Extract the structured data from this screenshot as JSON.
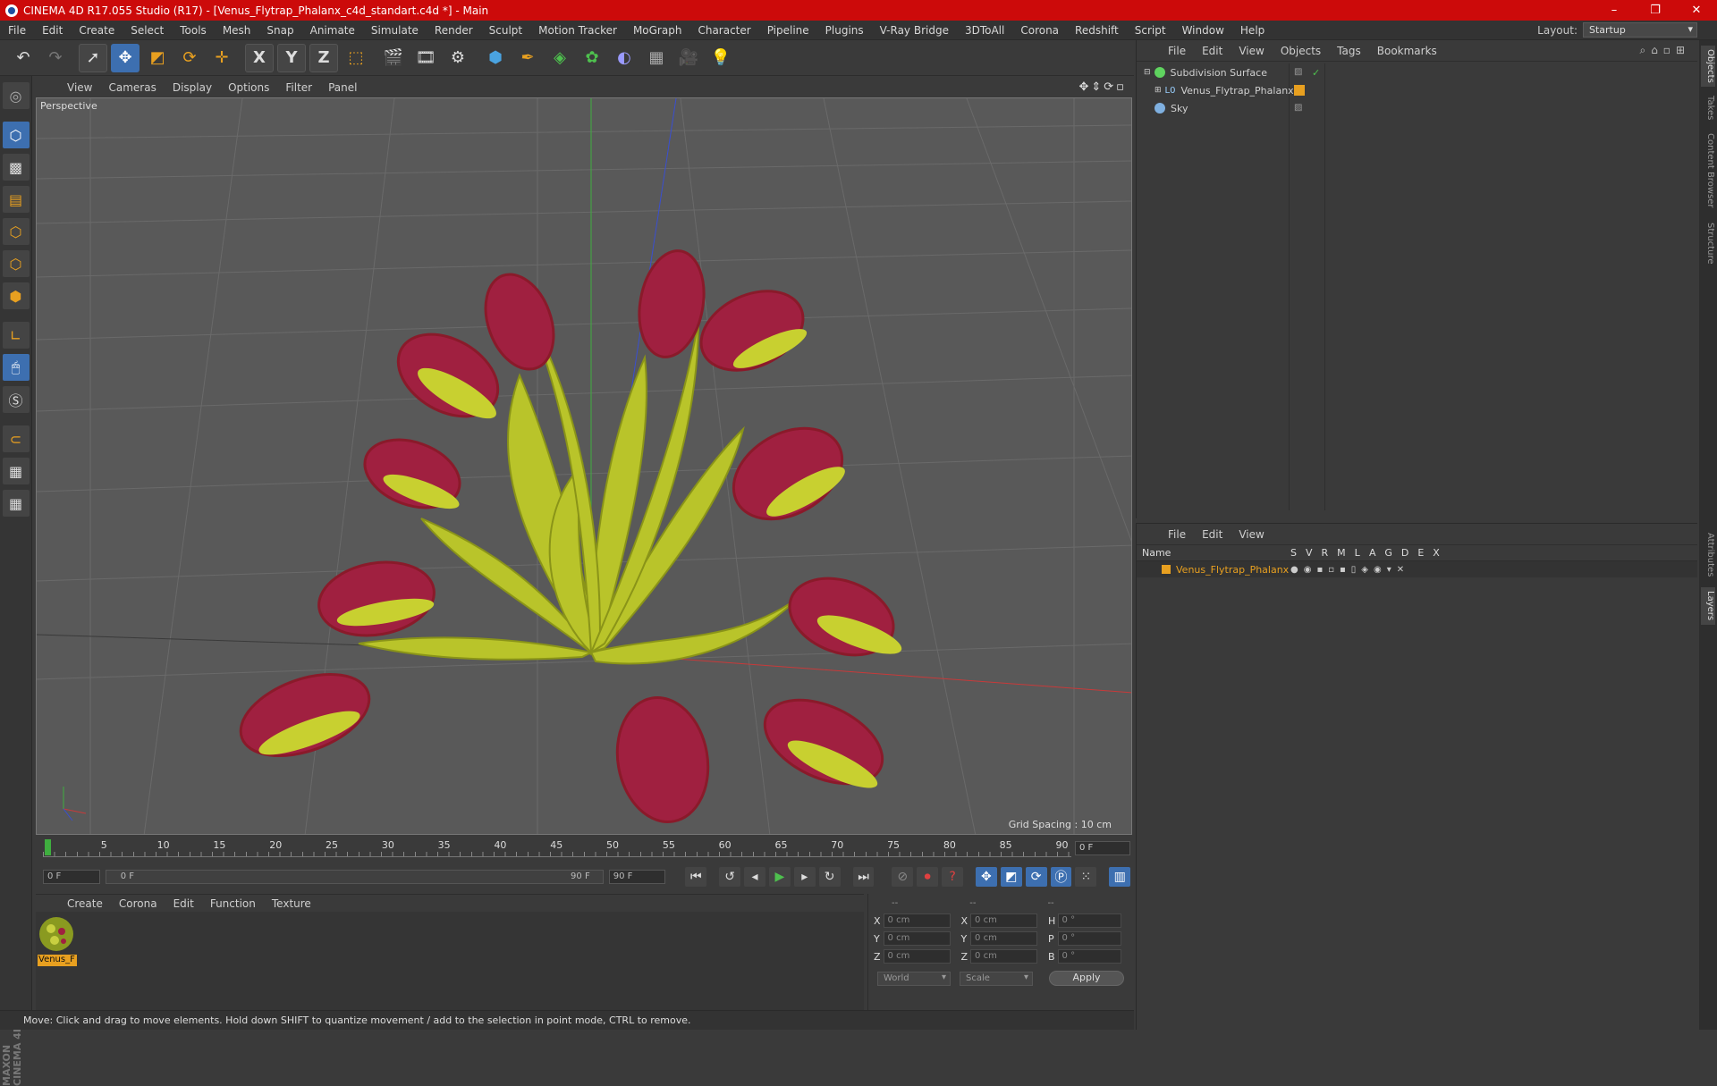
{
  "window": {
    "title": "CINEMA 4D R17.055 Studio (R17) - [Venus_Flytrap_Phalanx_c4d_standart.c4d *] - Main",
    "minimize": "–",
    "restore": "❐",
    "close": "✕"
  },
  "menu": [
    "File",
    "Edit",
    "Create",
    "Select",
    "Tools",
    "Mesh",
    "Snap",
    "Animate",
    "Simulate",
    "Render",
    "Sculpt",
    "Motion Tracker",
    "MoGraph",
    "Character",
    "Pipeline",
    "Plugins",
    "V-Ray Bridge",
    "3DToAll",
    "Corona",
    "Redshift",
    "Script",
    "Window",
    "Help"
  ],
  "layout": {
    "label": "Layout:",
    "value": "Startup"
  },
  "toolbar": {
    "x_label": "X",
    "y_label": "Y",
    "z_label": "Z"
  },
  "viewport": {
    "menu": [
      "View",
      "Cameras",
      "Display",
      "Options",
      "Filter",
      "Panel"
    ],
    "label": "Perspective",
    "grid_spacing": "Grid Spacing : 10 cm"
  },
  "timeline": {
    "ticks": [
      "0",
      "5",
      "10",
      "15",
      "20",
      "25",
      "30",
      "35",
      "40",
      "45",
      "50",
      "55",
      "60",
      "65",
      "70",
      "75",
      "80",
      "85",
      "90"
    ],
    "current_frame": "0 F",
    "start": "0 F",
    "range_start": "0 F",
    "range_end": "90 F",
    "end": "90 F"
  },
  "materials": {
    "menu": [
      "Create",
      "Corona",
      "Edit",
      "Function",
      "Texture"
    ],
    "items": [
      {
        "name": "Venus_F"
      }
    ]
  },
  "coordinates": {
    "headers": [
      "--",
      "--",
      "--"
    ],
    "rows": [
      {
        "a": "X",
        "pos": "0 cm",
        "b": "X",
        "size": "0 cm",
        "c": "H",
        "rot": "0 °"
      },
      {
        "a": "Y",
        "pos": "0 cm",
        "b": "Y",
        "size": "0 cm",
        "c": "P",
        "rot": "0 °"
      },
      {
        "a": "Z",
        "pos": "0 cm",
        "b": "Z",
        "size": "0 cm",
        "c": "B",
        "rot": "0 °"
      }
    ],
    "mode": "World",
    "transform": "Scale",
    "apply": "Apply"
  },
  "status": "Move: Click and drag to move elements. Hold down SHIFT to quantize movement / add to the selection in point mode, CTRL to remove.",
  "objects": {
    "menu": [
      "File",
      "Edit",
      "View",
      "Objects",
      "Tags",
      "Bookmarks"
    ],
    "items": [
      {
        "name": "Subdivision Surface",
        "color": "#5fd35f"
      },
      {
        "name": "Venus_Flytrap_Phalanx",
        "color": "#9ad0ff"
      },
      {
        "name": "Sky",
        "color": "#7fb0e0"
      }
    ]
  },
  "layers": {
    "menu": [
      "File",
      "Edit",
      "View"
    ],
    "header_name": "Name",
    "header_flags": "SVRMLAGDEX",
    "row": "Venus_Flytrap_Phalanx",
    "row_color": "#e8a020"
  },
  "right_tabs": [
    "Objects",
    "Takes",
    "Content Browser",
    "Structure",
    "Attributes",
    "Layers"
  ],
  "brand": "MAXON CINEMA 4D"
}
